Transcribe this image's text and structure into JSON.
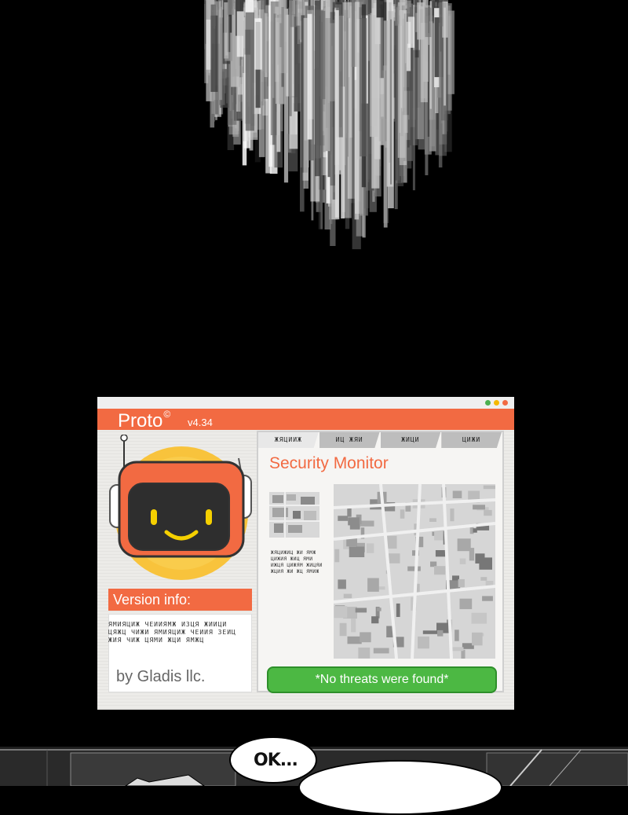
{
  "colors": {
    "accent": "#f26a42",
    "success": "#4cb843",
    "window_bg": "#ecebe8",
    "background": "#000000"
  },
  "window_dots": [
    "#4caf50",
    "#f5b800",
    "#f26a42"
  ],
  "app": {
    "name": "Proto",
    "copyright_mark": "©",
    "version": "v4.34"
  },
  "left_panel": {
    "mascot_icon": "robot-mascot-icon",
    "version_heading": "Version info:",
    "version_text": "ЯМИЯЦИЖ ЧЕИИЯМЖ ИЗЦЯ ЖИИЦИ ЦЯЖЦ ЧИЖИ ЯМИЯЦИЖ ЧЕИИЯ ЗЕИЦ ЖИЯ ЧИЖ ЦЯМИ ЖЦИ ЯМЖЦ",
    "company": "by Gladis llc."
  },
  "right_panel": {
    "tabs": [
      "ЖЯЦИИЖ",
      "ИЦ ЖЯИ",
      "ЖИЦИ",
      "ЦИЖИ"
    ],
    "title": "Security Monitor",
    "map_icon": "city-map-icon",
    "info_text": "ЖЯЦИЖИЦ ЖИ ЯМЖ ЦИЖИЯ ЖИЦ ЯМИ ИЖЦЯ ЦИЖЯМ ЖИЦЯИ ЖЦИЯ ЖИ ЖЦ ЯМИЖ",
    "status": "*No threats were found*"
  },
  "comic": {
    "bubble_text": "OK..."
  }
}
